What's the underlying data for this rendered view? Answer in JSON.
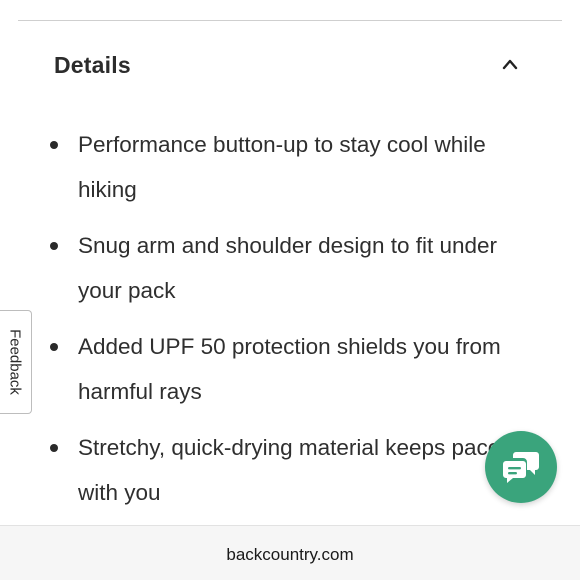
{
  "section": {
    "title": "Details",
    "expanded": true
  },
  "details": {
    "items": [
      {
        "text": "Performance button-up to stay cool while hiking"
      },
      {
        "text": "Snug arm and shoulder design to fit under your pack"
      },
      {
        "text": "Added UPF 50 protection shields you from harmful rays"
      },
      {
        "text": "Stretchy, quick-drying material keeps pace with you"
      }
    ]
  },
  "feedback": {
    "label": "Feedback"
  },
  "chat": {
    "icon": "chat-bubbles-icon",
    "color": "#3aa47c"
  },
  "browser": {
    "url": "backcountry.com"
  }
}
